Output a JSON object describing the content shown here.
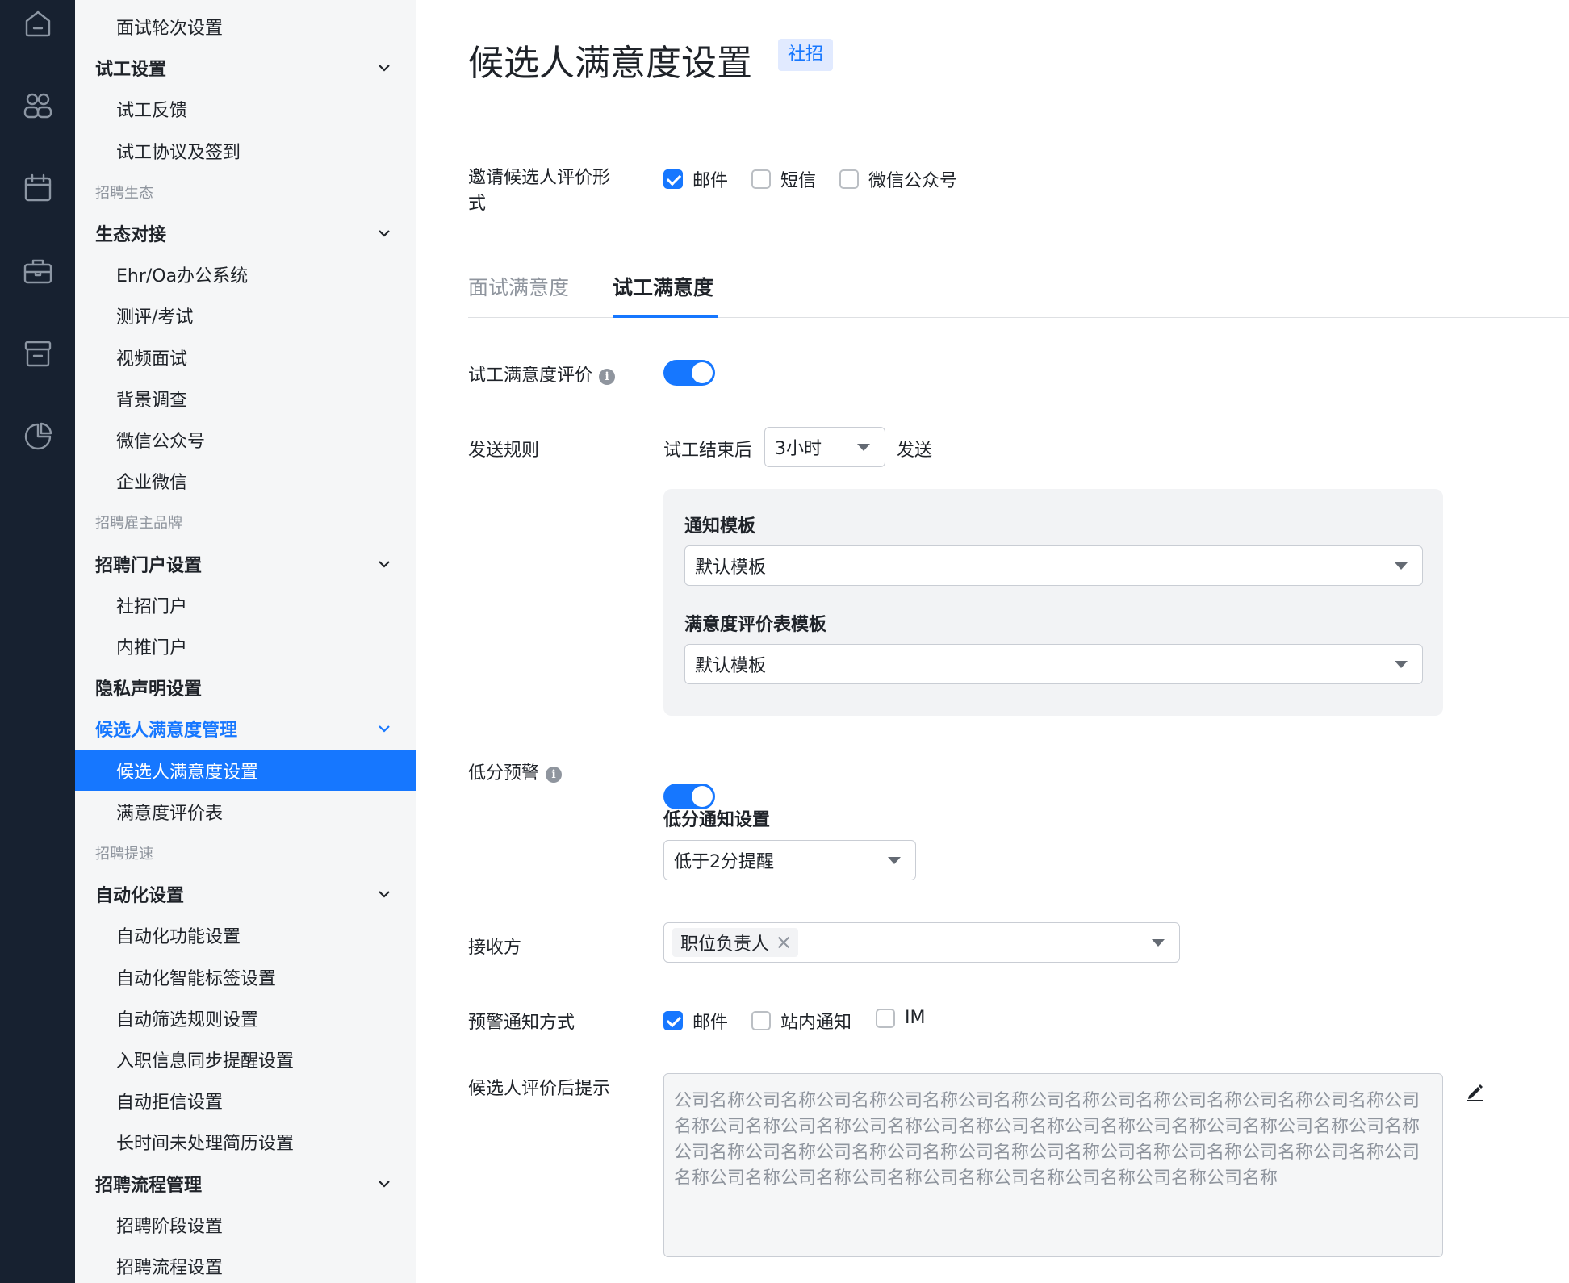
{
  "rail": {
    "icons": [
      "home-icon",
      "users-icon",
      "calendar-icon",
      "briefcase-icon",
      "archive-icon",
      "pie-chart-icon"
    ]
  },
  "sidenav": {
    "items": [
      {
        "type": "item",
        "label": "面试轮次设置"
      },
      {
        "type": "group",
        "label": "试工设置"
      },
      {
        "type": "item",
        "label": "试工反馈"
      },
      {
        "type": "item",
        "label": "试工协议及签到"
      },
      {
        "type": "section",
        "label": "招聘生态"
      },
      {
        "type": "group",
        "label": "生态对接"
      },
      {
        "type": "item",
        "label": "Ehr/Oa办公系统"
      },
      {
        "type": "item",
        "label": "测评/考试"
      },
      {
        "type": "item",
        "label": "视频面试"
      },
      {
        "type": "item",
        "label": "背景调查"
      },
      {
        "type": "item",
        "label": "微信公众号"
      },
      {
        "type": "item",
        "label": "企业微信"
      },
      {
        "type": "section",
        "label": "招聘雇主品牌"
      },
      {
        "type": "group",
        "label": "招聘门户设置"
      },
      {
        "type": "item",
        "label": "社招门户"
      },
      {
        "type": "item",
        "label": "内推门户"
      },
      {
        "type": "group",
        "label": "隐私声明设置"
      },
      {
        "type": "group",
        "label": "候选人满意度管理"
      },
      {
        "type": "item",
        "label": "候选人满意度设置"
      },
      {
        "type": "item",
        "label": "满意度评价表"
      },
      {
        "type": "section",
        "label": "招聘提速"
      },
      {
        "type": "group",
        "label": "自动化设置"
      },
      {
        "type": "item",
        "label": "自动化功能设置"
      },
      {
        "type": "item",
        "label": "自动化智能标签设置"
      },
      {
        "type": "item",
        "label": "自动筛选规则设置"
      },
      {
        "type": "item",
        "label": "入职信息同步提醒设置"
      },
      {
        "type": "item",
        "label": "自动拒信设置"
      },
      {
        "type": "item",
        "label": "长时间未处理简历设置"
      },
      {
        "type": "group",
        "label": "招聘流程管理"
      },
      {
        "type": "item",
        "label": "招聘阶段设置"
      },
      {
        "type": "item",
        "label": "招聘流程设置"
      }
    ]
  },
  "page": {
    "title": "候选人满意度设置",
    "tag": "社招"
  },
  "invite": {
    "label_line1": "邀请候选人评价形",
    "label_line2": "式",
    "options": [
      {
        "label": "邮件",
        "checked": true
      },
      {
        "label": "短信",
        "checked": false
      },
      {
        "label": "微信公众号",
        "checked": false
      }
    ]
  },
  "tabs": [
    {
      "label": "面试满意度",
      "active": false
    },
    {
      "label": "试工满意度",
      "active": true
    }
  ],
  "trial_eval": {
    "label": "试工满意度评价",
    "info": "i",
    "enabled": true
  },
  "send_rule": {
    "label": "发送规则",
    "prefix": "试工结束后",
    "delay": "3小时",
    "suffix": "发送"
  },
  "templates": {
    "notify_label": "通知模板",
    "notify_value": "默认模板",
    "form_label": "满意度评价表模板",
    "form_value": "默认模板"
  },
  "low_score": {
    "label": "低分预警",
    "info": "i",
    "enabled": true,
    "setting_label": "低分通知设置",
    "setting_value": "低于2分提醒"
  },
  "recipient": {
    "label": "接收方",
    "chip": "职位负责人"
  },
  "alert_method": {
    "label": "预警通知方式",
    "options": [
      {
        "label": "邮件",
        "checked": true
      },
      {
        "label": "站内通知",
        "checked": false
      },
      {
        "label": "IM",
        "checked": false
      }
    ]
  },
  "after_tip": {
    "label": "候选人评价后提示",
    "text": "公司名称公司名称公司名称公司名称公司名称公司名称公司名称公司名称公司名称公司名称公司名称公司名称公司名称公司名称公司名称公司名称公司名称公司名称公司名称公司名称公司名称公司名称公司名称公司名称公司名称公司名称公司名称公司名称公司名称公司名称公司名称公司名称公司名称公司名称公司名称公司名称公司名称公司名称公司名称公司名称",
    "edit_icon": "edit-icon"
  }
}
